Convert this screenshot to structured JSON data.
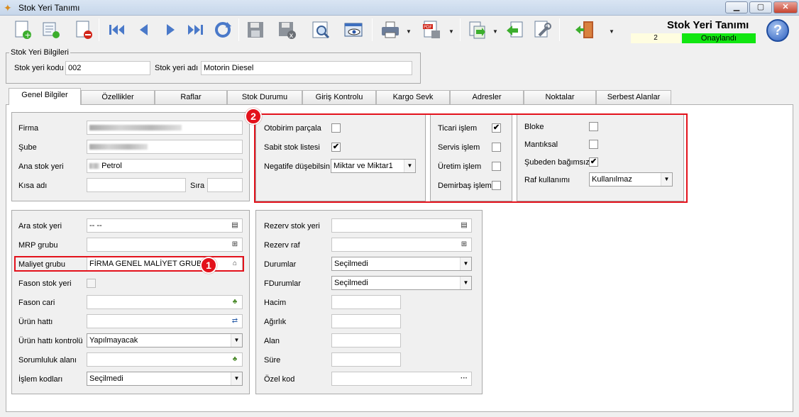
{
  "window": {
    "title": "Stok Yeri Tanımı",
    "minimize": "▁",
    "maximize": "▢",
    "close": "✕"
  },
  "header": {
    "title": "Stok Yeri Tanımı",
    "count": "2",
    "status": "Onaylandı",
    "help": "?"
  },
  "toolbar": {
    "icons": [
      "new-record-icon",
      "new-copy-icon",
      "delete-icon",
      "first-record-icon",
      "previous-record-icon",
      "next-record-icon",
      "last-record-icon",
      "refresh-icon",
      "save-icon",
      "cancel-save-icon",
      "search-icon",
      "preview-icon",
      "print-icon",
      "pdf-export-icon",
      "import-icon",
      "back-icon",
      "settings-icon",
      "exit-icon"
    ],
    "dropdown_arrow": "▼"
  },
  "stock_info": {
    "legend": "Stok Yeri Bilgileri",
    "code_label": "Stok yeri kodu",
    "code_value": "002",
    "name_label": "Stok yeri adı",
    "name_value": "Motorin Diesel"
  },
  "tabs": [
    "Genel Bilgiler",
    "Özellikler",
    "Raflar",
    "Stok Durumu",
    "Giriş Kontrolu",
    "Kargo Sevk",
    "Adresler",
    "Noktalar",
    "Serbest Alanlar"
  ],
  "general": {
    "firma_label": "Firma",
    "sube_label": "Şube",
    "ana_label": "Ana stok yeri",
    "ana_value": "Petrol",
    "kisa_label": "Kısa adı",
    "sira_label": "Sıra"
  },
  "options1": {
    "otobirim_label": "Otobirim parçala",
    "otobirim_checked": false,
    "sabit_label": "Sabit stok listesi",
    "sabit_checked": true,
    "negatif_label": "Negatife düşebilsin",
    "negatif_value": "Miktar ve Miktar1"
  },
  "options2": {
    "ticari_label": "Ticari işlem",
    "ticari_checked": true,
    "servis_label": "Servis işlem",
    "servis_checked": false,
    "uretim_label": "Üretim işlem",
    "uretim_checked": false,
    "demirbas_label": "Demirbaş işlem",
    "demirbas_checked": false
  },
  "options3": {
    "bloke_label": "Bloke",
    "bloke_checked": false,
    "mantiksal_label": "Mantıksal",
    "mantiksal_checked": false,
    "subeden_label": "Şubeden bağımsız",
    "subeden_checked": true,
    "raf_label": "Raf kullanımı",
    "raf_value": "Kullanılmaz"
  },
  "left_lower": {
    "ara_label": "Ara stok yeri",
    "ara_value": "-- --",
    "mrp_label": "MRP grubu",
    "maliyet_label": "Maliyet grubu",
    "maliyet_value": "FİRMA GENEL MALİYET GRUBU",
    "fason_stok_label": "Fason stok yeri",
    "fason_cari_label": "Fason cari",
    "urun_hatti_label": "Ürün hattı",
    "urun_kontrol_label": "Ürün hattı kontrolü",
    "urun_kontrol_value": "Yapılmayacak",
    "sorumluluk_label": "Sorumluluk alanı",
    "islem_label": "İşlem kodları",
    "islem_value": "Seçilmedi"
  },
  "right_lower": {
    "rezerv_stok_label": "Rezerv stok yeri",
    "rezerv_raf_label": "Rezerv raf",
    "durumlar_label": "Durumlar",
    "durumlar_value": "Seçilmedi",
    "fdurumlar_label": "FDurumlar",
    "fdurumlar_value": "Seçilmedi",
    "hacim_label": "Hacim",
    "agirlik_label": "Ağırlık",
    "alan_label": "Alan",
    "sure_label": "Süre",
    "ozel_label": "Özel kod",
    "ozel_button": "···"
  },
  "badges": {
    "one": "1",
    "two": "2"
  },
  "check_mark": "✔",
  "colors": {
    "highlight": "#e3111b",
    "status_bg": "#11e611"
  }
}
